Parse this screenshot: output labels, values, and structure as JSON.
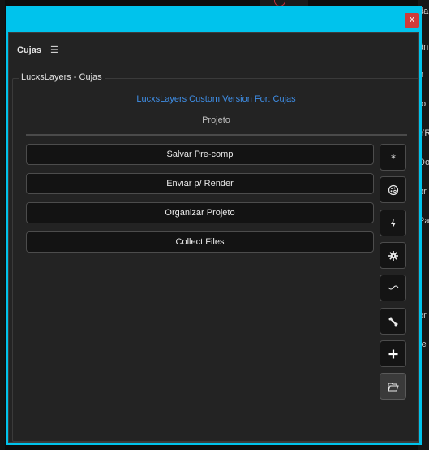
{
  "window": {
    "close_label": "x"
  },
  "panel": {
    "title": "Cujas",
    "menu_icon": "hamburger-menu-icon",
    "group_title": "LucxsLayers - Cujas",
    "subtitle": "LucxsLayers Custom Version For: Cujas",
    "section_title": "Projeto"
  },
  "actions": [
    {
      "label": "Salvar Pre-comp"
    },
    {
      "label": "Enviar p/ Render"
    },
    {
      "label": "Organizar Projeto"
    },
    {
      "label": "Collect Files"
    }
  ],
  "toolbar": [
    {
      "icon": "asterisk-icon"
    },
    {
      "icon": "palette-icon"
    },
    {
      "icon": "lightning-icon"
    },
    {
      "icon": "gear-icon"
    },
    {
      "icon": "wave-icon"
    },
    {
      "icon": "bone-icon"
    },
    {
      "icon": "plus-icon"
    },
    {
      "icon": "folder-open-icon",
      "active": true
    }
  ],
  "background_fragments": [
    "da",
    "ân",
    "n",
    "to",
    "YR",
    "Do",
    "br",
    "Pa",
    "er",
    "re"
  ],
  "colors": {
    "window_border": "#00c3ec",
    "subtitle": "#3f8fe8",
    "close_button": "#cf3a3a"
  }
}
